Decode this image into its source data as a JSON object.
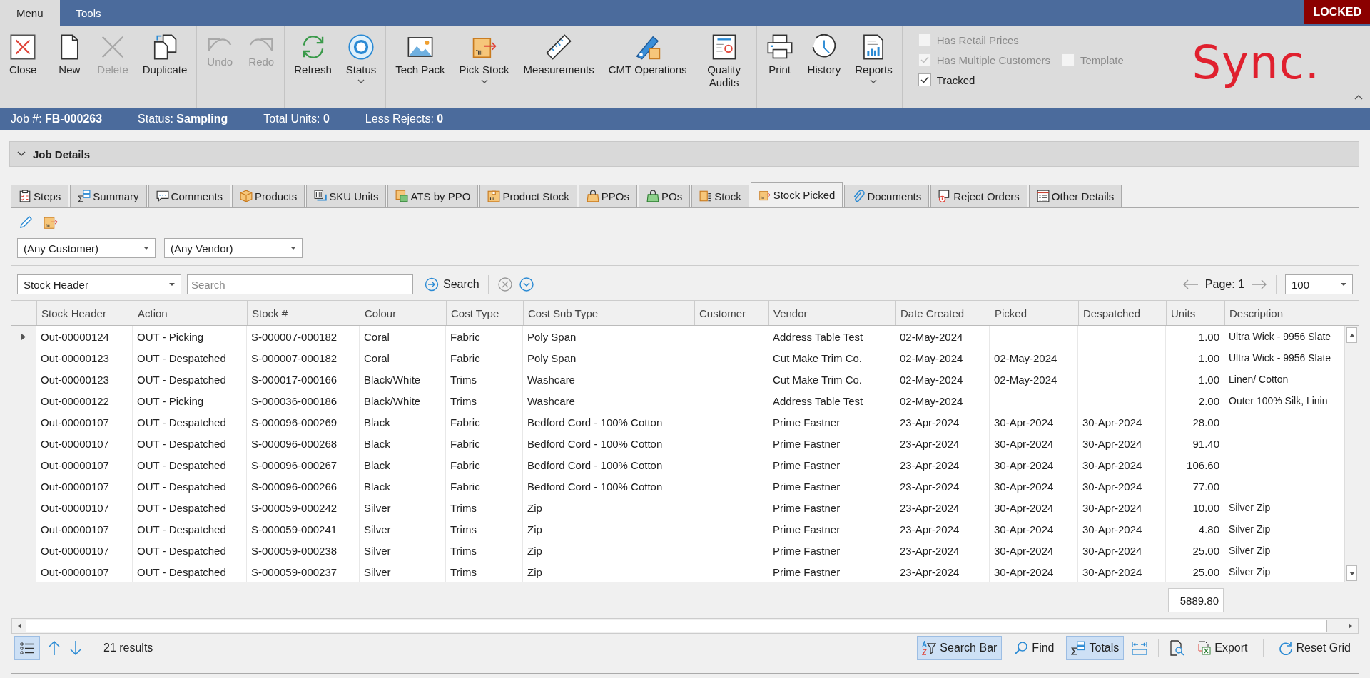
{
  "menu_tabs": [
    {
      "label": "Menu",
      "selected": true
    },
    {
      "label": "Tools",
      "selected": false
    }
  ],
  "lock_badge": "LOCKED",
  "ribbon": {
    "groups": [
      [
        {
          "label": "Close",
          "disabled": false,
          "dropdown": false
        }
      ],
      [
        {
          "label": "New",
          "disabled": false,
          "dropdown": false
        },
        {
          "label": "Delete",
          "disabled": true,
          "dropdown": false
        },
        {
          "label": "Duplicate",
          "disabled": false,
          "dropdown": false
        }
      ],
      [
        {
          "label": "Undo",
          "disabled": true,
          "dropdown": false
        },
        {
          "label": "Redo",
          "disabled": true,
          "dropdown": false
        }
      ],
      [
        {
          "label": "Refresh",
          "disabled": false,
          "dropdown": false
        },
        {
          "label": "Status",
          "disabled": false,
          "dropdown": true
        }
      ],
      [
        {
          "label": "Tech Pack",
          "disabled": false,
          "dropdown": false
        },
        {
          "label": "Pick Stock",
          "disabled": false,
          "dropdown": true
        },
        {
          "label": "Measurements",
          "disabled": false,
          "dropdown": false
        },
        {
          "label": "CMT Operations",
          "disabled": false,
          "dropdown": false
        },
        {
          "label": "Quality Audits",
          "disabled": false,
          "dropdown": false
        }
      ],
      [
        {
          "label": "Print",
          "disabled": false,
          "dropdown": false
        },
        {
          "label": "History",
          "disabled": false,
          "dropdown": false
        },
        {
          "label": "Reports",
          "disabled": false,
          "dropdown": true
        }
      ]
    ],
    "option_rows": [
      [
        {
          "label": "Has Retail Prices",
          "checked": false,
          "disabled": true
        }
      ],
      [
        {
          "label": "Has Multiple Customers",
          "checked": true,
          "disabled": true
        },
        {
          "label": "Template",
          "checked": false,
          "disabled": true
        }
      ],
      [
        {
          "label": "Tracked",
          "checked": true,
          "disabled": false
        }
      ]
    ],
    "logo": "Sync."
  },
  "job_bar": [
    {
      "label": "Job #:",
      "value": "FB-000263"
    },
    {
      "label": "Status:",
      "value": "Sampling"
    },
    {
      "label": "Total Units:",
      "value": "0"
    },
    {
      "label": "Less Rejects:",
      "value": "0"
    }
  ],
  "section": {
    "title": "Job Details",
    "expanded": true
  },
  "tabs": [
    {
      "label": "Steps",
      "selected": false
    },
    {
      "label": "Summary",
      "selected": false
    },
    {
      "label": "Comments",
      "selected": false
    },
    {
      "label": "Products",
      "selected": false
    },
    {
      "label": "SKU Units",
      "selected": false
    },
    {
      "label": "ATS by PPO",
      "selected": false
    },
    {
      "label": "Product Stock",
      "selected": false
    },
    {
      "label": "PPOs",
      "selected": false
    },
    {
      "label": "POs",
      "selected": false
    },
    {
      "label": "Stock",
      "selected": false
    },
    {
      "label": "Stock Picked",
      "selected": true
    },
    {
      "label": "Documents",
      "selected": false
    },
    {
      "label": "Reject Orders",
      "selected": false
    },
    {
      "label": "Other Details",
      "selected": false
    }
  ],
  "filters": {
    "customer": "(Any Customer)",
    "vendor": "(Any Vendor)"
  },
  "search_bar": {
    "field_choice": "Stock Header",
    "placeholder": "Search",
    "button": "Search",
    "page_label": "Page: 1",
    "page_size": "100"
  },
  "table": {
    "columns": [
      "Stock Header",
      "Action",
      "Stock #",
      "Colour",
      "Cost Type",
      "Cost Sub Type",
      "Customer",
      "Vendor",
      "Date Created",
      "Picked",
      "Despatched",
      "Units",
      "Description"
    ],
    "rows": [
      {
        "current": true,
        "cells": [
          "Out-00000124",
          "OUT - Picking",
          "S-000007-000182",
          "Coral",
          "Fabric",
          "Poly Span",
          "",
          "Address Table Test",
          "02-May-2024",
          "",
          "",
          "1.00",
          "Ultra Wick - 9956 Slate"
        ]
      },
      {
        "current": false,
        "cells": [
          "Out-00000123",
          "OUT - Despatched",
          "S-000007-000182",
          "Coral",
          "Fabric",
          "Poly Span",
          "",
          "Cut Make Trim Co.",
          "02-May-2024",
          "02-May-2024",
          "",
          "1.00",
          "Ultra Wick - 9956 Slate"
        ]
      },
      {
        "current": false,
        "cells": [
          "Out-00000123",
          "OUT - Despatched",
          "S-000017-000166",
          "Black/White",
          "Trims",
          "Washcare",
          "",
          "Cut Make Trim Co.",
          "02-May-2024",
          "02-May-2024",
          "",
          "1.00",
          "Linen/ Cotton"
        ]
      },
      {
        "current": false,
        "cells": [
          "Out-00000122",
          "OUT - Picking",
          "S-000036-000186",
          "Black/White",
          "Trims",
          "Washcare",
          "",
          "Address Table Test",
          "02-May-2024",
          "",
          "",
          "2.00",
          "Outer 100% Silk, Linin"
        ]
      },
      {
        "current": false,
        "cells": [
          "Out-00000107",
          "OUT - Despatched",
          "S-000096-000269",
          "Black",
          "Fabric",
          "Bedford Cord - 100% Cotton",
          "",
          "Prime Fastner",
          "23-Apr-2024",
          "30-Apr-2024",
          "30-Apr-2024",
          "28.00",
          ""
        ]
      },
      {
        "current": false,
        "cells": [
          "Out-00000107",
          "OUT - Despatched",
          "S-000096-000268",
          "Black",
          "Fabric",
          "Bedford Cord - 100% Cotton",
          "",
          "Prime Fastner",
          "23-Apr-2024",
          "30-Apr-2024",
          "30-Apr-2024",
          "91.40",
          ""
        ]
      },
      {
        "current": false,
        "cells": [
          "Out-00000107",
          "OUT - Despatched",
          "S-000096-000267",
          "Black",
          "Fabric",
          "Bedford Cord - 100% Cotton",
          "",
          "Prime Fastner",
          "23-Apr-2024",
          "30-Apr-2024",
          "30-Apr-2024",
          "106.60",
          ""
        ]
      },
      {
        "current": false,
        "cells": [
          "Out-00000107",
          "OUT - Despatched",
          "S-000096-000266",
          "Black",
          "Fabric",
          "Bedford Cord - 100% Cotton",
          "",
          "Prime Fastner",
          "23-Apr-2024",
          "30-Apr-2024",
          "30-Apr-2024",
          "77.00",
          ""
        ]
      },
      {
        "current": false,
        "cells": [
          "Out-00000107",
          "OUT - Despatched",
          "S-000059-000242",
          "Silver",
          "Trims",
          "Zip",
          "",
          "Prime Fastner",
          "23-Apr-2024",
          "30-Apr-2024",
          "30-Apr-2024",
          "10.00",
          "Silver Zip"
        ]
      },
      {
        "current": false,
        "cells": [
          "Out-00000107",
          "OUT - Despatched",
          "S-000059-000241",
          "Silver",
          "Trims",
          "Zip",
          "",
          "Prime Fastner",
          "23-Apr-2024",
          "30-Apr-2024",
          "30-Apr-2024",
          "4.80",
          "Silver Zip"
        ]
      },
      {
        "current": false,
        "cells": [
          "Out-00000107",
          "OUT - Despatched",
          "S-000059-000238",
          "Silver",
          "Trims",
          "Zip",
          "",
          "Prime Fastner",
          "23-Apr-2024",
          "30-Apr-2024",
          "30-Apr-2024",
          "25.00",
          "Silver Zip"
        ]
      },
      {
        "current": false,
        "cells": [
          "Out-00000107",
          "OUT - Despatched",
          "S-000059-000237",
          "Silver",
          "Trims",
          "Zip",
          "",
          "Prime Fastner",
          "23-Apr-2024",
          "30-Apr-2024",
          "30-Apr-2024",
          "25.00",
          "Silver Zip"
        ]
      }
    ],
    "total": "5889.80"
  },
  "status_bar": {
    "results": "21 results",
    "view_toggle": {
      "selected": true
    },
    "tools": [
      {
        "label": "Search Bar",
        "selected": true
      },
      {
        "label": "Find",
        "selected": false
      },
      {
        "label": "Totals",
        "selected": true
      },
      {
        "label": "Export",
        "selected": false
      },
      {
        "label": "Reset Grid",
        "selected": false
      }
    ]
  }
}
